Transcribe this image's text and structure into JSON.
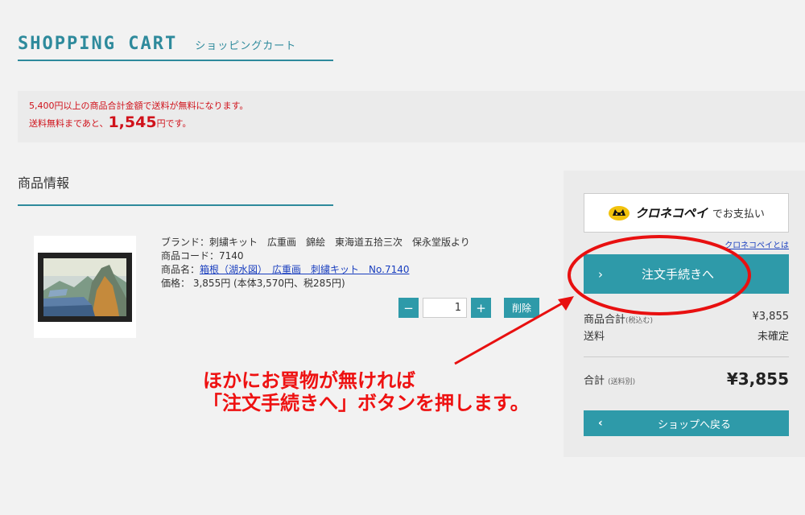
{
  "header": {
    "title_en": "SHOPPING CART",
    "title_jp": "ショッピングカート"
  },
  "notice": {
    "free_shipping_rule": "5,400円以上の商品合計金額で送料が無料になります。",
    "remaining_prefix": "送料無料まであと、",
    "remaining_amount": "1,545",
    "remaining_suffix": "円です。"
  },
  "product_section": {
    "title": "商品情報",
    "item": {
      "brand_label": "ブランド：",
      "brand": "刺繍キット　広重画　錦絵　東海道五拾三次　保永堂版より",
      "code_label": "商品コード：",
      "code": "7140",
      "name_label": "商品名：",
      "name": "箱根（湖水図）　広重画　刺繍キット　No.7140",
      "price_label": "価格：",
      "price": "3,855円 (本体3,570円、税285円)",
      "quantity": "1",
      "minus_label": "−",
      "plus_label": "+",
      "delete_label": "削除"
    }
  },
  "sidebar": {
    "kuroneko_brand": "クロネコペイ",
    "kuroneko_pay": "でお支払い",
    "kuroneko_link": "クロネコペイとは",
    "checkout_label": "注文手続きへ",
    "subtotal_label": "商品合計",
    "subtotal_note": "(税込む)",
    "subtotal_value": "¥3,855",
    "shipping_label": "送料",
    "shipping_value": "未確定",
    "total_label": "合計",
    "total_note": "(送料別)",
    "total_value": "¥3,855",
    "back_label": "ショップへ戻る",
    "chevron_right": "›",
    "chevron_left": "‹"
  },
  "annotation": {
    "line1": "ほかにお買物が無ければ",
    "line2": "「注文手続きへ」ボタンを押します。"
  },
  "colors": {
    "accent": "#2e9aa9",
    "title_teal": "#2e8a9c",
    "notice_red": "#d0121b",
    "annotation_red": "#ee1111"
  }
}
